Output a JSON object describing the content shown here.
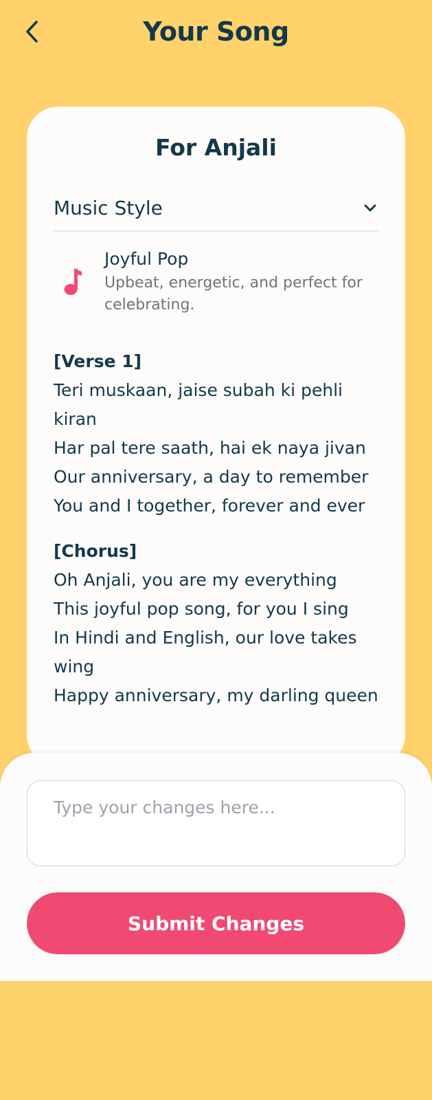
{
  "header": {
    "title": "Your Song",
    "back_icon": "chevron-left-icon"
  },
  "card": {
    "title": "For Anjali",
    "music_style": {
      "label": "Music Style",
      "toggle_icon": "chevron-down-icon",
      "selected": {
        "icon": "music-note-icon",
        "name": "Joyful Pop",
        "description": "Upbeat, energetic, and perfect for celebrating."
      }
    },
    "lyrics": [
      {
        "heading": "[Verse 1]",
        "lines": [
          "Teri muskaan, jaise subah ki pehli kiran",
          "Har pal tere saath, hai ek naya jivan",
          "Our anniversary, a day to remember",
          "You and I together, forever and ever"
        ]
      },
      {
        "heading": "[Chorus]",
        "lines": [
          "Oh Anjali, you are my everything",
          "This joyful pop song, for you I sing",
          "In Hindi and English, our love takes wing",
          "Happy anniversary, my darling queen"
        ]
      }
    ]
  },
  "sheet": {
    "input_placeholder": "Type your changes here...",
    "input_value": "",
    "submit_label": "Submit Changes"
  },
  "colors": {
    "background": "#FFD26C",
    "text_dark": "#13394A",
    "accent_pink": "#F04A73",
    "muted_text": "#6F737B"
  }
}
